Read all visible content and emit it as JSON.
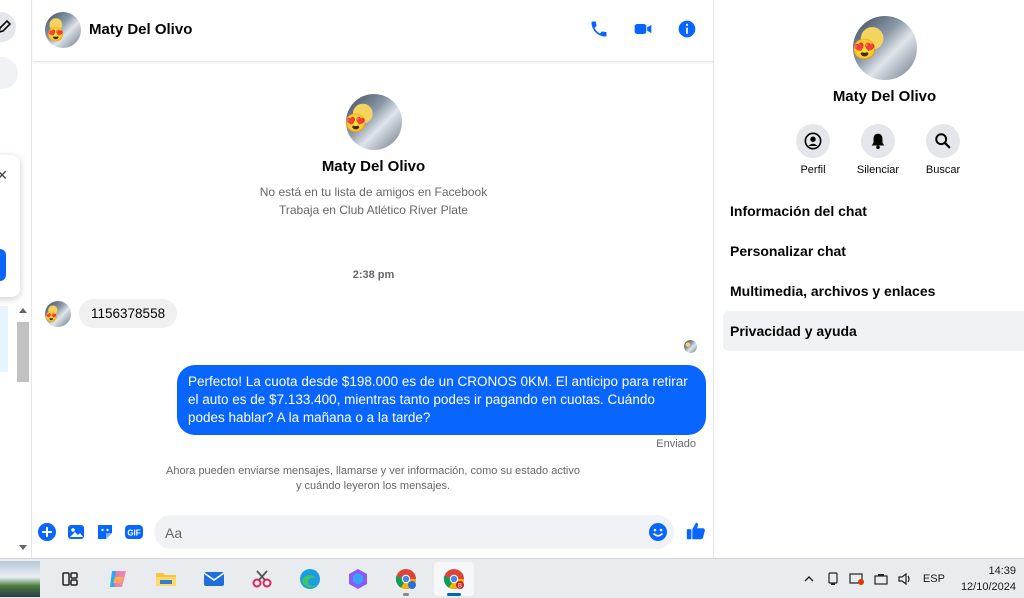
{
  "contact": {
    "name": "Maty Del Olivo",
    "friend_status": "No está en tu lista de amigos en Facebook",
    "work": "Trabaja en Club Atlético River Plate"
  },
  "header": {
    "icons": [
      "phone-icon",
      "video-call-icon",
      "info-icon"
    ]
  },
  "conversation": {
    "timestamp": "2:38 pm",
    "incoming_message": "1156378558",
    "outgoing_message": "Perfecto! La cuota desde $198.000 es de un CRONOS 0KM. El anticipo para retirar el auto es de $7.133.400, mientras tanto podes ir pagando en cuotas. Cuándo podes hablar? A la mañana o a la tarde?",
    "sent_status": "Enviado",
    "info_line1": "Ahora pueden enviarse mensajes, llamarse y ver información, como su estado activo",
    "info_line2": "y cuándo leyeron los mensajes."
  },
  "composer": {
    "placeholder": "Aa",
    "icons": [
      "plus-icon",
      "gallery-icon",
      "sticker-icon",
      "gif-icon",
      "emoji-icon",
      "like-icon"
    ]
  },
  "info_panel": {
    "actions": [
      {
        "label": "Perfil",
        "icon": "profile-icon"
      },
      {
        "label": "Silenciar",
        "icon": "bell-icon"
      },
      {
        "label": "Buscar",
        "icon": "search-icon"
      }
    ],
    "menu": [
      "Información del chat",
      "Personalizar chat",
      "Multimedia, archivos y enlaces",
      "Privacidad y ayuda"
    ]
  },
  "taskbar": {
    "apps": [
      "task-view-icon",
      "copilot-icon",
      "file-explorer-icon",
      "mail-icon",
      "snipping-tool-icon",
      "edge-icon",
      "copilot-app-icon",
      "chrome-profile-icon",
      "chrome-icon"
    ],
    "language": "ESP",
    "time": "14:39",
    "date": "12/10/2024"
  },
  "colors": {
    "accent": "#0866ff",
    "bubble_incoming": "#f0f0f0",
    "muted_text": "#65676b"
  }
}
